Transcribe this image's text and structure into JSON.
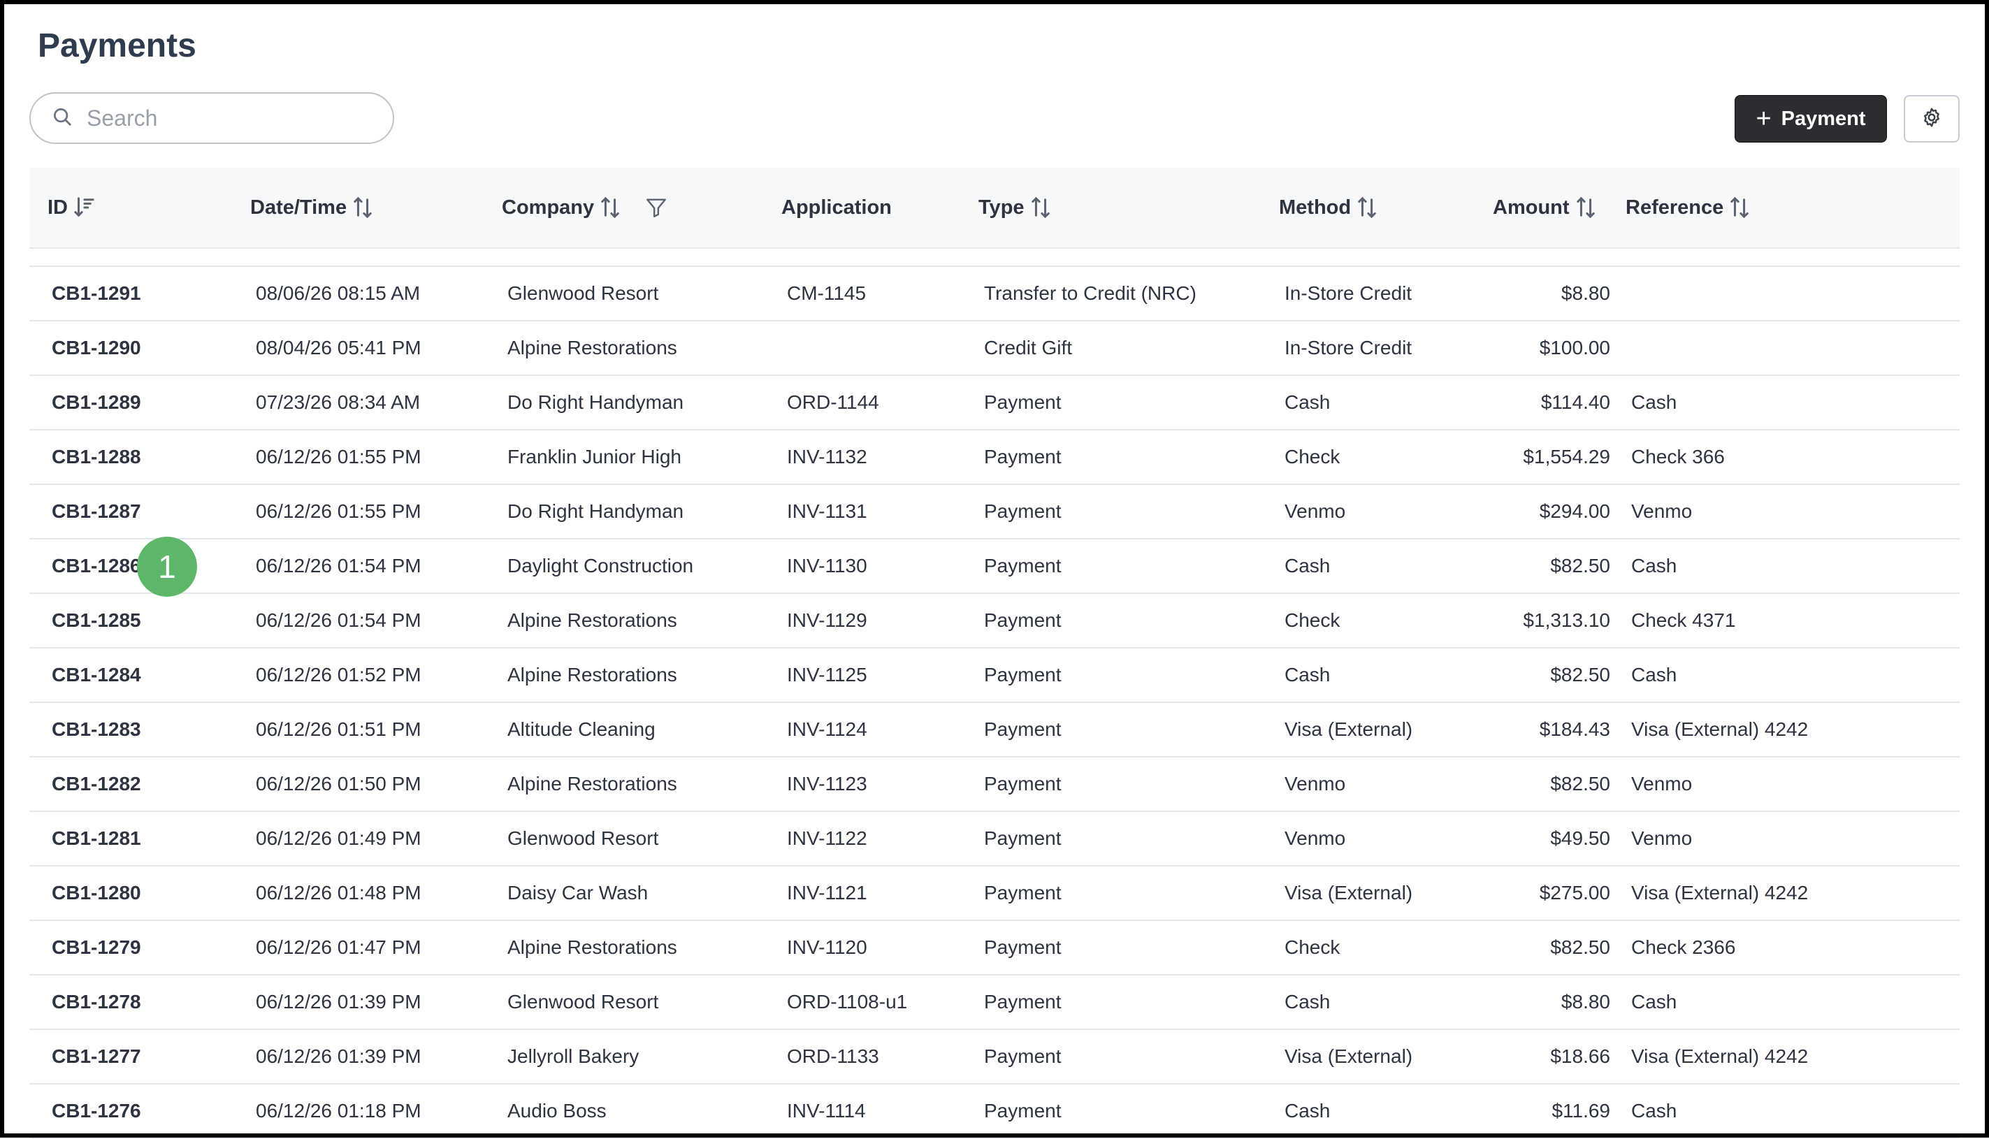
{
  "page": {
    "title": "Payments"
  },
  "search": {
    "placeholder": "Search"
  },
  "toolbar": {
    "add_payment_label": "Payment"
  },
  "table": {
    "columns": {
      "id": "ID",
      "datetime": "Date/Time",
      "company": "Company",
      "application": "Application",
      "type": "Type",
      "method": "Method",
      "amount": "Amount",
      "reference": "Reference"
    },
    "rows": [
      {
        "id": "CB1-1291",
        "datetime": "08/06/26 08:15 AM",
        "company": "Glenwood Resort",
        "application": "CM-1145",
        "type": "Transfer to Credit (NRC)",
        "method": "In-Store Credit",
        "amount": "$8.80",
        "reference": ""
      },
      {
        "id": "CB1-1290",
        "datetime": "08/04/26 05:41 PM",
        "company": "Alpine Restorations",
        "application": "",
        "type": "Credit Gift",
        "method": "In-Store Credit",
        "amount": "$100.00",
        "reference": ""
      },
      {
        "id": "CB1-1289",
        "datetime": "07/23/26 08:34 AM",
        "company": "Do Right Handyman",
        "application": "ORD-1144",
        "type": "Payment",
        "method": "Cash",
        "amount": "$114.40",
        "reference": "Cash"
      },
      {
        "id": "CB1-1288",
        "datetime": "06/12/26 01:55 PM",
        "company": "Franklin Junior High",
        "application": "INV-1132",
        "type": "Payment",
        "method": "Check",
        "amount": "$1,554.29",
        "reference": "Check 366"
      },
      {
        "id": "CB1-1287",
        "datetime": "06/12/26 01:55 PM",
        "company": "Do Right Handyman",
        "application": "INV-1131",
        "type": "Payment",
        "method": "Venmo",
        "amount": "$294.00",
        "reference": "Venmo"
      },
      {
        "id": "CB1-1286",
        "datetime": "06/12/26 01:54 PM",
        "company": "Daylight Construction",
        "application": "INV-1130",
        "type": "Payment",
        "method": "Cash",
        "amount": "$82.50",
        "reference": "Cash"
      },
      {
        "id": "CB1-1285",
        "datetime": "06/12/26 01:54 PM",
        "company": "Alpine Restorations",
        "application": "INV-1129",
        "type": "Payment",
        "method": "Check",
        "amount": "$1,313.10",
        "reference": "Check 4371"
      },
      {
        "id": "CB1-1284",
        "datetime": "06/12/26 01:52 PM",
        "company": "Alpine Restorations",
        "application": "INV-1125",
        "type": "Payment",
        "method": "Cash",
        "amount": "$82.50",
        "reference": "Cash"
      },
      {
        "id": "CB1-1283",
        "datetime": "06/12/26 01:51 PM",
        "company": "Altitude Cleaning",
        "application": "INV-1124",
        "type": "Payment",
        "method": "Visa (External)",
        "amount": "$184.43",
        "reference": "Visa (External) 4242"
      },
      {
        "id": "CB1-1282",
        "datetime": "06/12/26 01:50 PM",
        "company": "Alpine Restorations",
        "application": "INV-1123",
        "type": "Payment",
        "method": "Venmo",
        "amount": "$82.50",
        "reference": "Venmo"
      },
      {
        "id": "CB1-1281",
        "datetime": "06/12/26 01:49 PM",
        "company": "Glenwood Resort",
        "application": "INV-1122",
        "type": "Payment",
        "method": "Venmo",
        "amount": "$49.50",
        "reference": "Venmo"
      },
      {
        "id": "CB1-1280",
        "datetime": "06/12/26 01:48 PM",
        "company": "Daisy Car Wash",
        "application": "INV-1121",
        "type": "Payment",
        "method": "Visa (External)",
        "amount": "$275.00",
        "reference": "Visa (External) 4242"
      },
      {
        "id": "CB1-1279",
        "datetime": "06/12/26 01:47 PM",
        "company": "Alpine Restorations",
        "application": "INV-1120",
        "type": "Payment",
        "method": "Check",
        "amount": "$82.50",
        "reference": "Check 2366"
      },
      {
        "id": "CB1-1278",
        "datetime": "06/12/26 01:39 PM",
        "company": "Glenwood Resort",
        "application": "ORD-1108-u1",
        "type": "Payment",
        "method": "Cash",
        "amount": "$8.80",
        "reference": "Cash"
      },
      {
        "id": "CB1-1277",
        "datetime": "06/12/26 01:39 PM",
        "company": "Jellyroll Bakery",
        "application": "ORD-1133",
        "type": "Payment",
        "method": "Visa (External)",
        "amount": "$18.66",
        "reference": "Visa (External) 4242"
      },
      {
        "id": "CB1-1276",
        "datetime": "06/12/26 01:18 PM",
        "company": "Audio Boss",
        "application": "INV-1114",
        "type": "Payment",
        "method": "Cash",
        "amount": "$11.69",
        "reference": "Cash"
      }
    ]
  },
  "annotation": {
    "badge_label": "1",
    "color": "#5cb868"
  },
  "colors": {
    "primary_button": "#2b2d31",
    "header_bg": "#f7f8fa",
    "border": "#e3e6ea"
  },
  "icons": {
    "search": "search-icon",
    "settings": "gear-icon",
    "sort": "sort-icon",
    "sort_desc": "sort-desc-icon",
    "filter": "filter-icon",
    "add": "plus-icon"
  }
}
